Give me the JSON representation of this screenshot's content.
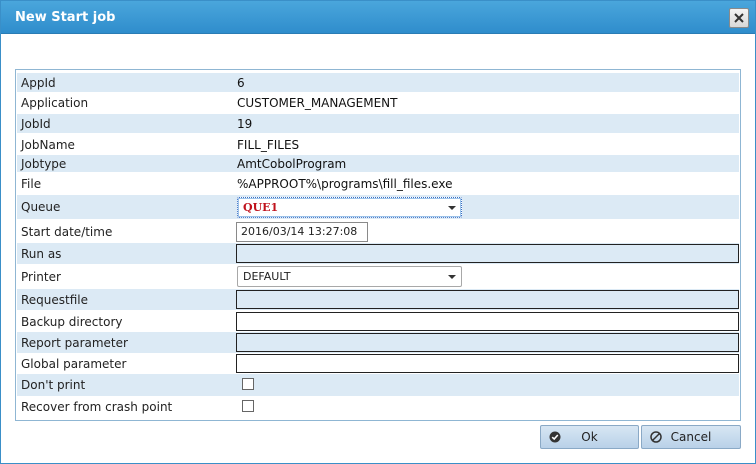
{
  "dialog": {
    "title": "New Start job",
    "close_icon": "close-icon"
  },
  "fields": {
    "appid": {
      "label": "AppId",
      "value": "6"
    },
    "application": {
      "label": "Application",
      "value": "CUSTOMER_MANAGEMENT"
    },
    "jobid": {
      "label": "JobId",
      "value": "19"
    },
    "jobname": {
      "label": "JobName",
      "value": "FILL_FILES"
    },
    "jobtype": {
      "label": "Jobtype",
      "value": "AmtCobolProgram"
    },
    "file": {
      "label": "File",
      "value": "%APPROOT%\\programs\\fill_files.exe"
    },
    "queue": {
      "label": "Queue",
      "selected": "QUE1"
    },
    "start_datetime": {
      "label": "Start date/time",
      "value": "2016/03/14 13:27:08"
    },
    "run_as": {
      "label": "Run as",
      "value": ""
    },
    "printer": {
      "label": "Printer",
      "selected": "DEFAULT"
    },
    "requestfile": {
      "label": "Requestfile",
      "value": ""
    },
    "backup_directory": {
      "label": "Backup directory",
      "value": ""
    },
    "report_parameter": {
      "label": "Report parameter",
      "value": ""
    },
    "global_parameter": {
      "label": "Global parameter",
      "value": ""
    },
    "dont_print": {
      "label": "Don't print",
      "checked": false
    },
    "recover_crash": {
      "label": "Recover from crash point",
      "checked": false
    }
  },
  "buttons": {
    "ok": {
      "label": "Ok",
      "icon": "check-circle-icon"
    },
    "cancel": {
      "label": "Cancel",
      "icon": "cancel-circle-icon"
    }
  },
  "colors": {
    "titlebar": "#2f8dcc",
    "row_shade": "#dceaf5",
    "queue_text": "#c0121c"
  }
}
